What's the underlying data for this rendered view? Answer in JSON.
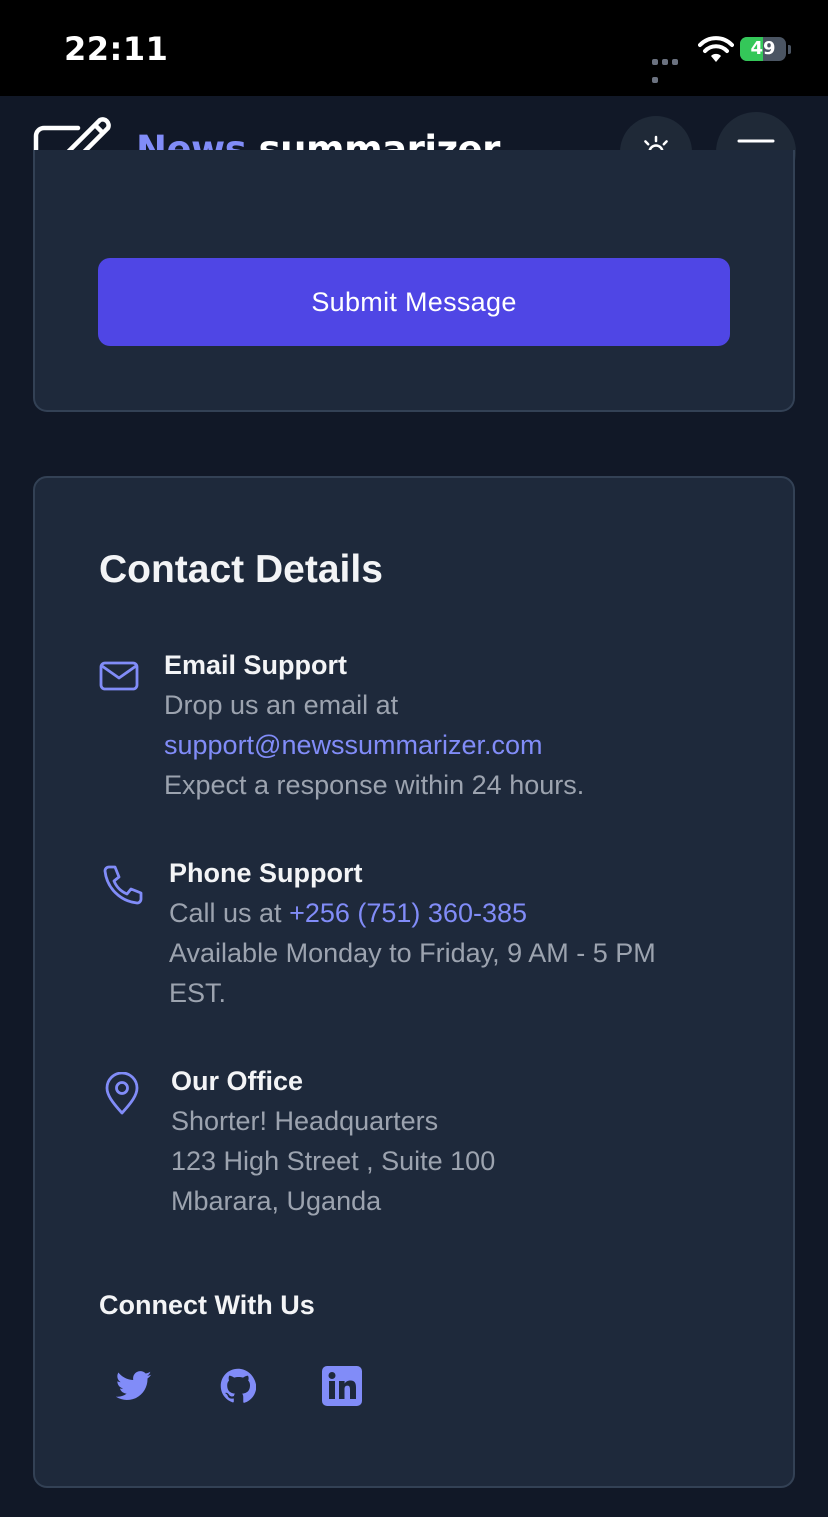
{
  "status_bar": {
    "time": "22:11",
    "battery_percent": "49",
    "battery_level": 0.49,
    "icons": [
      "cellular-signal-icon",
      "wifi-icon",
      "battery-charging-icon"
    ]
  },
  "header": {
    "brand_part1": "News",
    "brand_part2": "summarizer",
    "logo_icon": "edit-note-icon",
    "theme_toggle_icon": "sun-icon",
    "menu_icon": "hamburger-menu-icon"
  },
  "form": {
    "submit_label": "Submit Message"
  },
  "contact": {
    "title": "Contact Details",
    "email": {
      "icon": "mail-icon",
      "title": "Email Support",
      "line1": "Drop us an email at",
      "link": "support@newssummarizer.com",
      "line3": "Expect a response within 24 hours."
    },
    "phone": {
      "icon": "phone-icon",
      "title": "Phone Support",
      "prefix": "Call us at ",
      "link": "+256 (751) 360-385",
      "line2": "Available Monday to Friday, 9 AM - 5 PM",
      "line3": "EST."
    },
    "office": {
      "icon": "map-pin-icon",
      "title": "Our Office",
      "line1": "Shorter! Headquarters",
      "line2": "123 High Street , Suite 100",
      "line3": "Mbarara, Uganda"
    }
  },
  "connect": {
    "title": "Connect With Us",
    "socials": [
      "twitter-icon",
      "github-icon",
      "linkedin-icon"
    ]
  },
  "colors": {
    "background": "#111827",
    "card": "#1e293b",
    "accent": "#4f46e5",
    "accent_light": "#818cf8",
    "muted_text": "#9ca3af"
  }
}
